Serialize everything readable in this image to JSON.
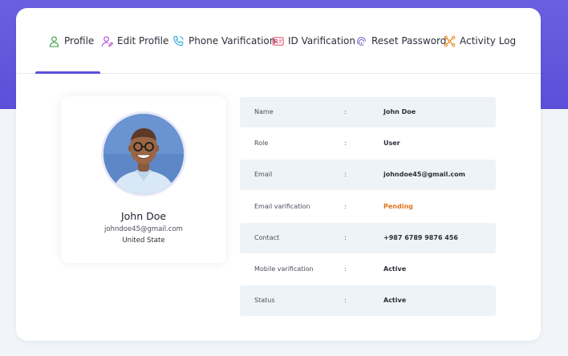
{
  "tabs": [
    {
      "label": "Profile",
      "icon": "user-icon",
      "color": "#43a047",
      "active": true
    },
    {
      "label": "Edit Profile",
      "icon": "user-edit-icon",
      "color": "#b04fd6"
    },
    {
      "label": "Phone Varification",
      "icon": "phone-icon",
      "color": "#29a8d8"
    },
    {
      "label": "ID Varification",
      "icon": "id-card-icon",
      "color": "#e45b7c"
    },
    {
      "label": "Reset Password",
      "icon": "fingerprint-icon",
      "color": "#7b5cc6"
    },
    {
      "label": "Activity Log",
      "icon": "activity-icon",
      "color": "#e8891c"
    }
  ],
  "profile": {
    "name": "John Doe",
    "email": "johndoe45@gmail.com",
    "location": "United State"
  },
  "details": {
    "separator": ":",
    "rows": [
      {
        "label": "Name",
        "value": "John Doe"
      },
      {
        "label": "Role",
        "value": "User"
      },
      {
        "label": "Email",
        "value": "johndoe45@gmail.com"
      },
      {
        "label": "Email varification",
        "value": "Pending"
      },
      {
        "label": "Contact",
        "value": "+987 6789 9876 456"
      },
      {
        "label": "Mobile varification",
        "value": "Active"
      },
      {
        "label": "Status",
        "value": "Active"
      }
    ]
  },
  "colors": {
    "accent": "#5b4fd9",
    "pending": "#e0731c",
    "row_shade": "#eef3f7"
  }
}
